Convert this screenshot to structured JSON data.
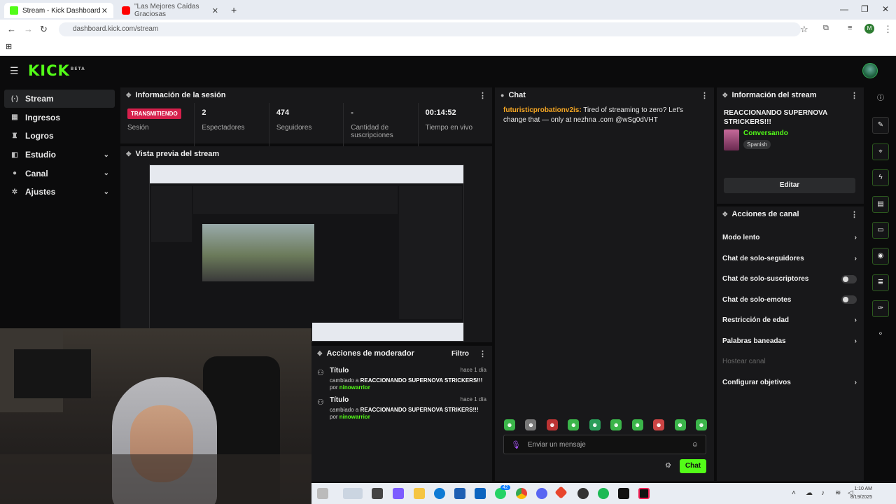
{
  "browser": {
    "tabs": [
      {
        "title": "Stream - Kick Dashboard",
        "favicon_color": "#53fc18"
      },
      {
        "title": "\"Las Mejores Caídas Graciosas",
        "favicon_color": "#ff0000"
      }
    ],
    "url": "dashboard.kick.com/stream",
    "profile_initial": "M"
  },
  "app": {
    "logo": "KICK",
    "logo_tag": "BETA",
    "accent": "#53fc18",
    "sidebar": [
      {
        "label": "Stream",
        "icon": "broadcast-icon",
        "glyph": "(·)",
        "active": true
      },
      {
        "label": "Ingresos",
        "icon": "bar-chart-icon",
        "glyph": "▦"
      },
      {
        "label": "Logros",
        "icon": "trophy-icon",
        "glyph": "♜"
      },
      {
        "label": "Estudio",
        "icon": "studio-icon",
        "glyph": "◧",
        "expandable": true
      },
      {
        "label": "Canal",
        "icon": "user-icon",
        "glyph": "●",
        "expandable": true
      },
      {
        "label": "Ajustes",
        "icon": "gear-icon",
        "glyph": "✲",
        "expandable": true
      }
    ]
  },
  "session": {
    "title": "Información de la sesión",
    "status_badge": "TRANSMITIENDO",
    "status_label": "Sesión",
    "stats": [
      {
        "value": "2",
        "label": "Espectadores"
      },
      {
        "value": "474",
        "label": "Seguidores"
      },
      {
        "value": "-",
        "label": "Cantidad de suscripciones"
      },
      {
        "value": "00:14:52",
        "label": "Tiempo en vivo"
      }
    ]
  },
  "preview": {
    "title": "Vista previa del stream"
  },
  "moderator": {
    "title": "Acciones de moderador",
    "filter_label": "Filtro",
    "items": [
      {
        "heading": "Título",
        "time": "hace 1 día",
        "changed_prefix": "cambiado a",
        "value": "REACCIONANDO SUPERNOVA STRICKERS!!!",
        "by_prefix": "por",
        "user": "ninowarrior"
      },
      {
        "heading": "Título",
        "time": "hace 1 día",
        "changed_prefix": "cambiado a",
        "value": "REACCIONANDO SUPERNOVA STRIKERS!!!",
        "by_prefix": "por",
        "user": "ninowarrior"
      }
    ]
  },
  "chat": {
    "title": "Chat",
    "messages": [
      {
        "user": "futuristicprobationv2is:",
        "text": " Tired of streaming to zero? Let's change that — only at nezhna .com @wSg0dVHT"
      }
    ],
    "input_placeholder": "Enviar un mensaje",
    "send_label": "Chat"
  },
  "stream_info": {
    "title": "Información del stream",
    "stream_title": "REACCIONANDO SUPERNOVA STRICKERS!!!",
    "category": "Conversando",
    "language": "Spanish",
    "edit_label": "Editar"
  },
  "channel_actions": {
    "title": "Acciones de canal",
    "items": [
      {
        "label": "Modo lento",
        "control": "chevron"
      },
      {
        "label": "Chat de solo-seguidores",
        "control": "chevron"
      },
      {
        "label": "Chat de solo-suscriptores",
        "control": "toggle"
      },
      {
        "label": "Chat de solo-emotes",
        "control": "toggle"
      },
      {
        "label": "Restricción de edad",
        "control": "chevron"
      },
      {
        "label": "Palabras baneadas",
        "control": "chevron"
      },
      {
        "label": "Hostear canal",
        "control": "disabled"
      },
      {
        "label": "Configurar objetivos",
        "control": "chevron"
      }
    ]
  },
  "taskbar": {
    "time": "1:10 AM",
    "date": "8/19/2025",
    "discord_badge": "42"
  }
}
